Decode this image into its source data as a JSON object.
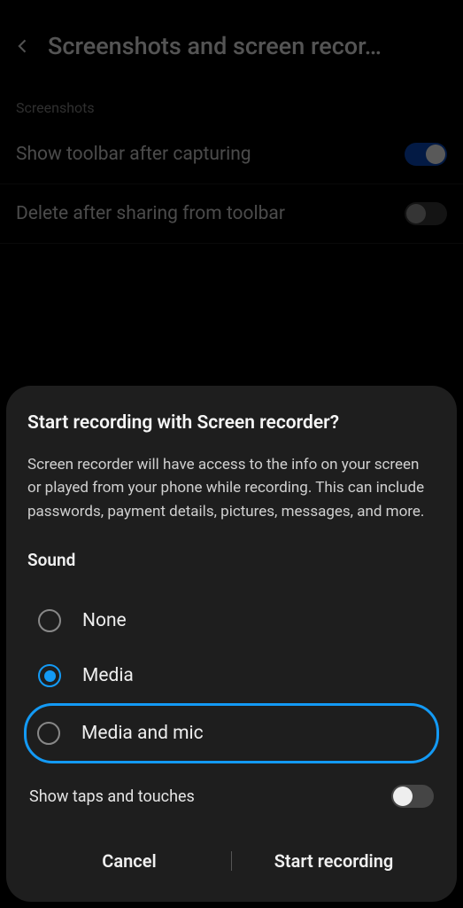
{
  "header": {
    "title": "Screenshots and screen recor…"
  },
  "bg": {
    "section_label": "Screenshots",
    "items": [
      {
        "label": "Show toolbar after capturing",
        "on": true
      },
      {
        "label": "Delete after sharing from toolbar",
        "on": false
      }
    ]
  },
  "modal": {
    "title": "Start recording with Screen recorder?",
    "body": "Screen recorder will have access to the info on your screen or played from your phone while recording. This can include passwords, payment details, pictures, messages, and more.",
    "sound_label": "Sound",
    "options": [
      {
        "label": "None",
        "selected": false,
        "highlighted": false
      },
      {
        "label": "Media",
        "selected": true,
        "highlighted": false
      },
      {
        "label": "Media and mic",
        "selected": false,
        "highlighted": true
      }
    ],
    "taps_label": "Show taps and touches",
    "taps_on": false,
    "cancel": "Cancel",
    "start": "Start recording"
  }
}
